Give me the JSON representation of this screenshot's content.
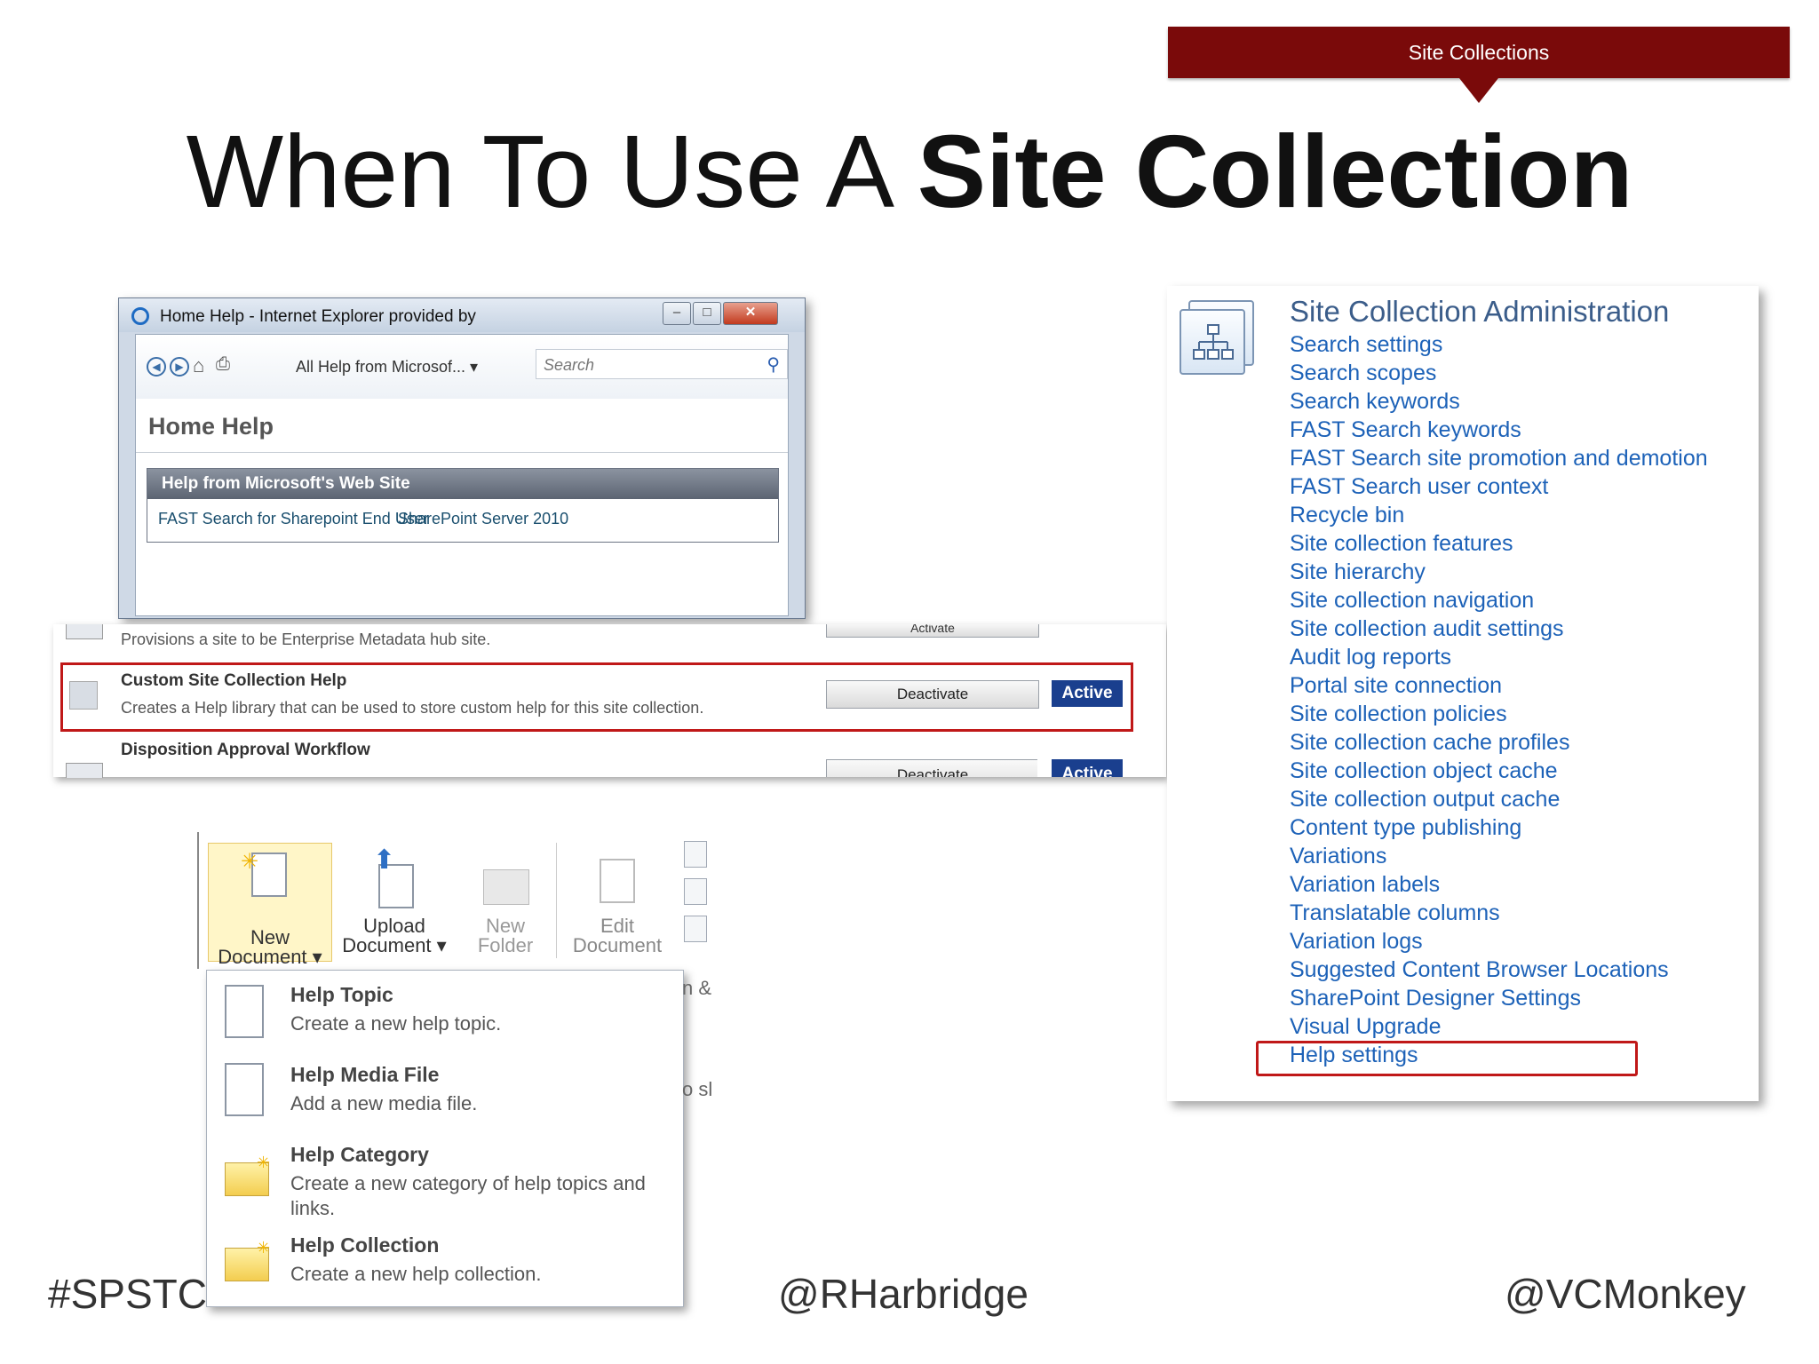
{
  "banner": {
    "label": "Site Collections"
  },
  "title": {
    "prefix": "When To Use A ",
    "bold": "Site Collection"
  },
  "ie_window": {
    "title": "Home Help - Internet Explorer provided by",
    "scope": "All Help from Microsof... ▾",
    "search_placeholder": "Search",
    "page_heading": "Home Help",
    "section_heading": "Help from Microsoft's Web Site",
    "links": [
      "FAST Search for Sharepoint End User",
      "SharePoint Server 2010"
    ]
  },
  "features": {
    "partial_top": {
      "desc": "Provisions a site to be Enterprise Metadata hub site.",
      "button": "Activate"
    },
    "help": {
      "name": "Custom Site Collection Help",
      "desc": "Creates a Help library that can be used to store custom help for this site collection.",
      "button": "Deactivate",
      "status": "Active"
    },
    "disposition": {
      "name": "Disposition Approval Workflow",
      "button": "Deactivate",
      "status": "Active"
    }
  },
  "ribbon": {
    "new_document": [
      "New",
      "Document ▾"
    ],
    "upload_document": [
      "Upload",
      "Document ▾"
    ],
    "new_folder": [
      "New",
      "Folder"
    ],
    "edit_document": [
      "Edit",
      "Document"
    ]
  },
  "new_menu": [
    {
      "title": "Help Topic",
      "desc": "Create a new help topic.",
      "icon": "document-icon"
    },
    {
      "title": "Help Media File",
      "desc": "Add a new media file.",
      "icon": "document-icon"
    },
    {
      "title": "Help Category",
      "desc": "Create a new category of help topics and links.",
      "icon": "folder-icon"
    },
    {
      "title": "Help Collection",
      "desc": "Create a new help collection.",
      "icon": "folder-icon"
    }
  ],
  "menu_side_fragments": [
    "n &",
    "o sl"
  ],
  "admin": {
    "title": "Site Collection Administration",
    "links": [
      "Search settings",
      "Search scopes",
      "Search keywords",
      "FAST Search keywords",
      "FAST Search site promotion and demotion",
      "FAST Search user context",
      "Recycle bin",
      "Site collection features",
      "Site hierarchy",
      "Site collection navigation",
      "Site collection audit settings",
      "Audit log reports",
      "Portal site connection",
      "Site collection policies",
      "Site collection cache profiles",
      "Site collection object cache",
      "Site collection output cache",
      "Content type publishing",
      "Variations",
      "Variation labels",
      "Translatable columns",
      "Variation logs",
      "Suggested Content Browser Locations",
      "SharePoint Designer Settings",
      "Visual Upgrade",
      "Help settings"
    ],
    "highlighted": "Help settings"
  },
  "footer": {
    "left": "#SPSTC",
    "center": "@RHarbridge",
    "right": "@VCMonkey"
  },
  "colors": {
    "banner": "#7a0a0a",
    "highlight": "#c01818",
    "link": "#1d62b8",
    "active_badge": "#1a3f8e"
  }
}
